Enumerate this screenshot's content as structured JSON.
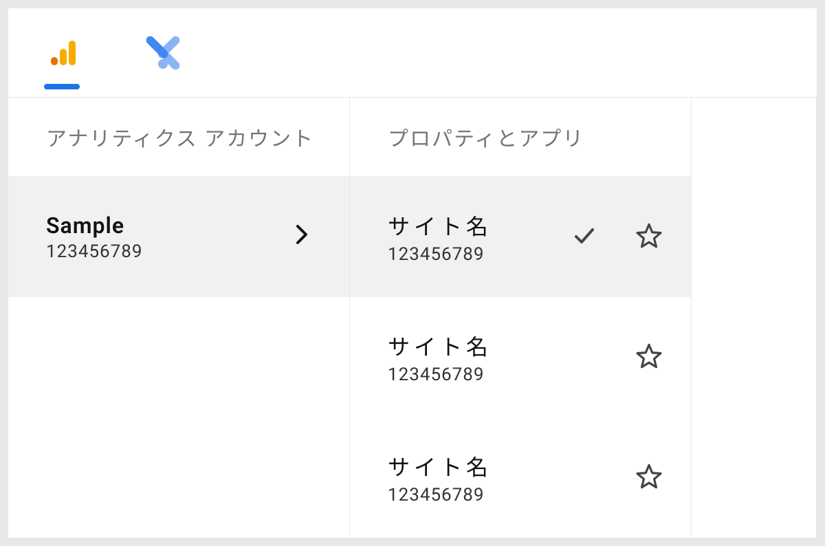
{
  "tabs": {
    "analytics_label": "Analytics",
    "tagmanager_label": "Tag Manager"
  },
  "columns": {
    "accounts_header": "アナリティクス アカウント",
    "properties_header": "プロパティとアプリ"
  },
  "accounts": [
    {
      "name": "Sample",
      "id": "123456789",
      "selected": true
    }
  ],
  "properties": [
    {
      "name": "サイト名",
      "id": "123456789",
      "checked": true,
      "starred": false
    },
    {
      "name": "サイト名",
      "id": "123456789",
      "checked": false,
      "starred": false
    },
    {
      "name": "サイト名",
      "id": "123456789",
      "checked": false,
      "starred": false
    }
  ]
}
